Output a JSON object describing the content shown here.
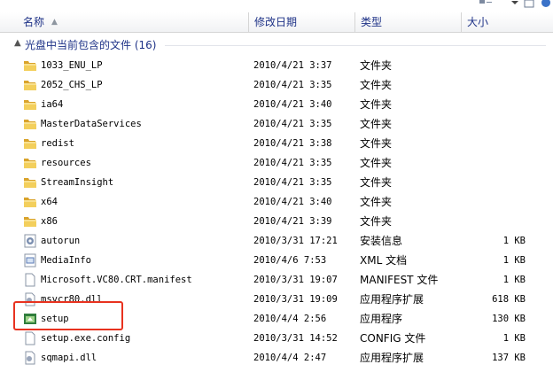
{
  "header": {
    "columns": [
      {
        "label": "名称",
        "sorted": "ascending"
      },
      {
        "label": "修改日期"
      },
      {
        "label": "类型"
      },
      {
        "label": "大小"
      }
    ]
  },
  "group": {
    "label": "光盘中当前包含的文件 (16)"
  },
  "files": [
    {
      "name": "1033_ENU_LP",
      "date": "2010/4/21 3:37",
      "type": "文件夹",
      "size": "",
      "icon": "folder-icon"
    },
    {
      "name": "2052_CHS_LP",
      "date": "2010/4/21 3:35",
      "type": "文件夹",
      "size": "",
      "icon": "folder-icon"
    },
    {
      "name": "ia64",
      "date": "2010/4/21 3:40",
      "type": "文件夹",
      "size": "",
      "icon": "folder-icon"
    },
    {
      "name": "MasterDataServices",
      "date": "2010/4/21 3:35",
      "type": "文件夹",
      "size": "",
      "icon": "folder-icon"
    },
    {
      "name": "redist",
      "date": "2010/4/21 3:38",
      "type": "文件夹",
      "size": "",
      "icon": "folder-icon"
    },
    {
      "name": "resources",
      "date": "2010/4/21 3:35",
      "type": "文件夹",
      "size": "",
      "icon": "folder-icon"
    },
    {
      "name": "StreamInsight",
      "date": "2010/4/21 3:35",
      "type": "文件夹",
      "size": "",
      "icon": "folder-icon"
    },
    {
      "name": "x64",
      "date": "2010/4/21 3:40",
      "type": "文件夹",
      "size": "",
      "icon": "folder-icon"
    },
    {
      "name": "x86",
      "date": "2010/4/21 3:39",
      "type": "文件夹",
      "size": "",
      "icon": "folder-icon"
    },
    {
      "name": "autorun",
      "date": "2010/3/31 17:21",
      "type": "安装信息",
      "size": "1 KB",
      "icon": "setup-info-icon"
    },
    {
      "name": "MediaInfo",
      "date": "2010/4/6 7:53",
      "type": "XML 文档",
      "size": "1 KB",
      "icon": "xml-document-icon"
    },
    {
      "name": "Microsoft.VC80.CRT.manifest",
      "date": "2010/3/31 19:07",
      "type": "MANIFEST 文件",
      "size": "1 KB",
      "icon": "file-icon"
    },
    {
      "name": "msvcr80.dll",
      "date": "2010/3/31 19:09",
      "type": "应用程序扩展",
      "size": "618 KB",
      "icon": "dll-icon"
    },
    {
      "name": "setup",
      "date": "2010/4/4 2:56",
      "type": "应用程序",
      "size": "130 KB",
      "icon": "application-icon"
    },
    {
      "name": "setup.exe.config",
      "date": "2010/3/31 14:52",
      "type": "CONFIG 文件",
      "size": "1 KB",
      "icon": "file-icon"
    },
    {
      "name": "sqmapi.dll",
      "date": "2010/4/4 2:47",
      "type": "应用程序扩展",
      "size": "137 KB",
      "icon": "dll-icon"
    }
  ],
  "colors": {
    "header_text": "#1e3287",
    "highlight": "#e8321f",
    "folder": "#e8b63a"
  }
}
